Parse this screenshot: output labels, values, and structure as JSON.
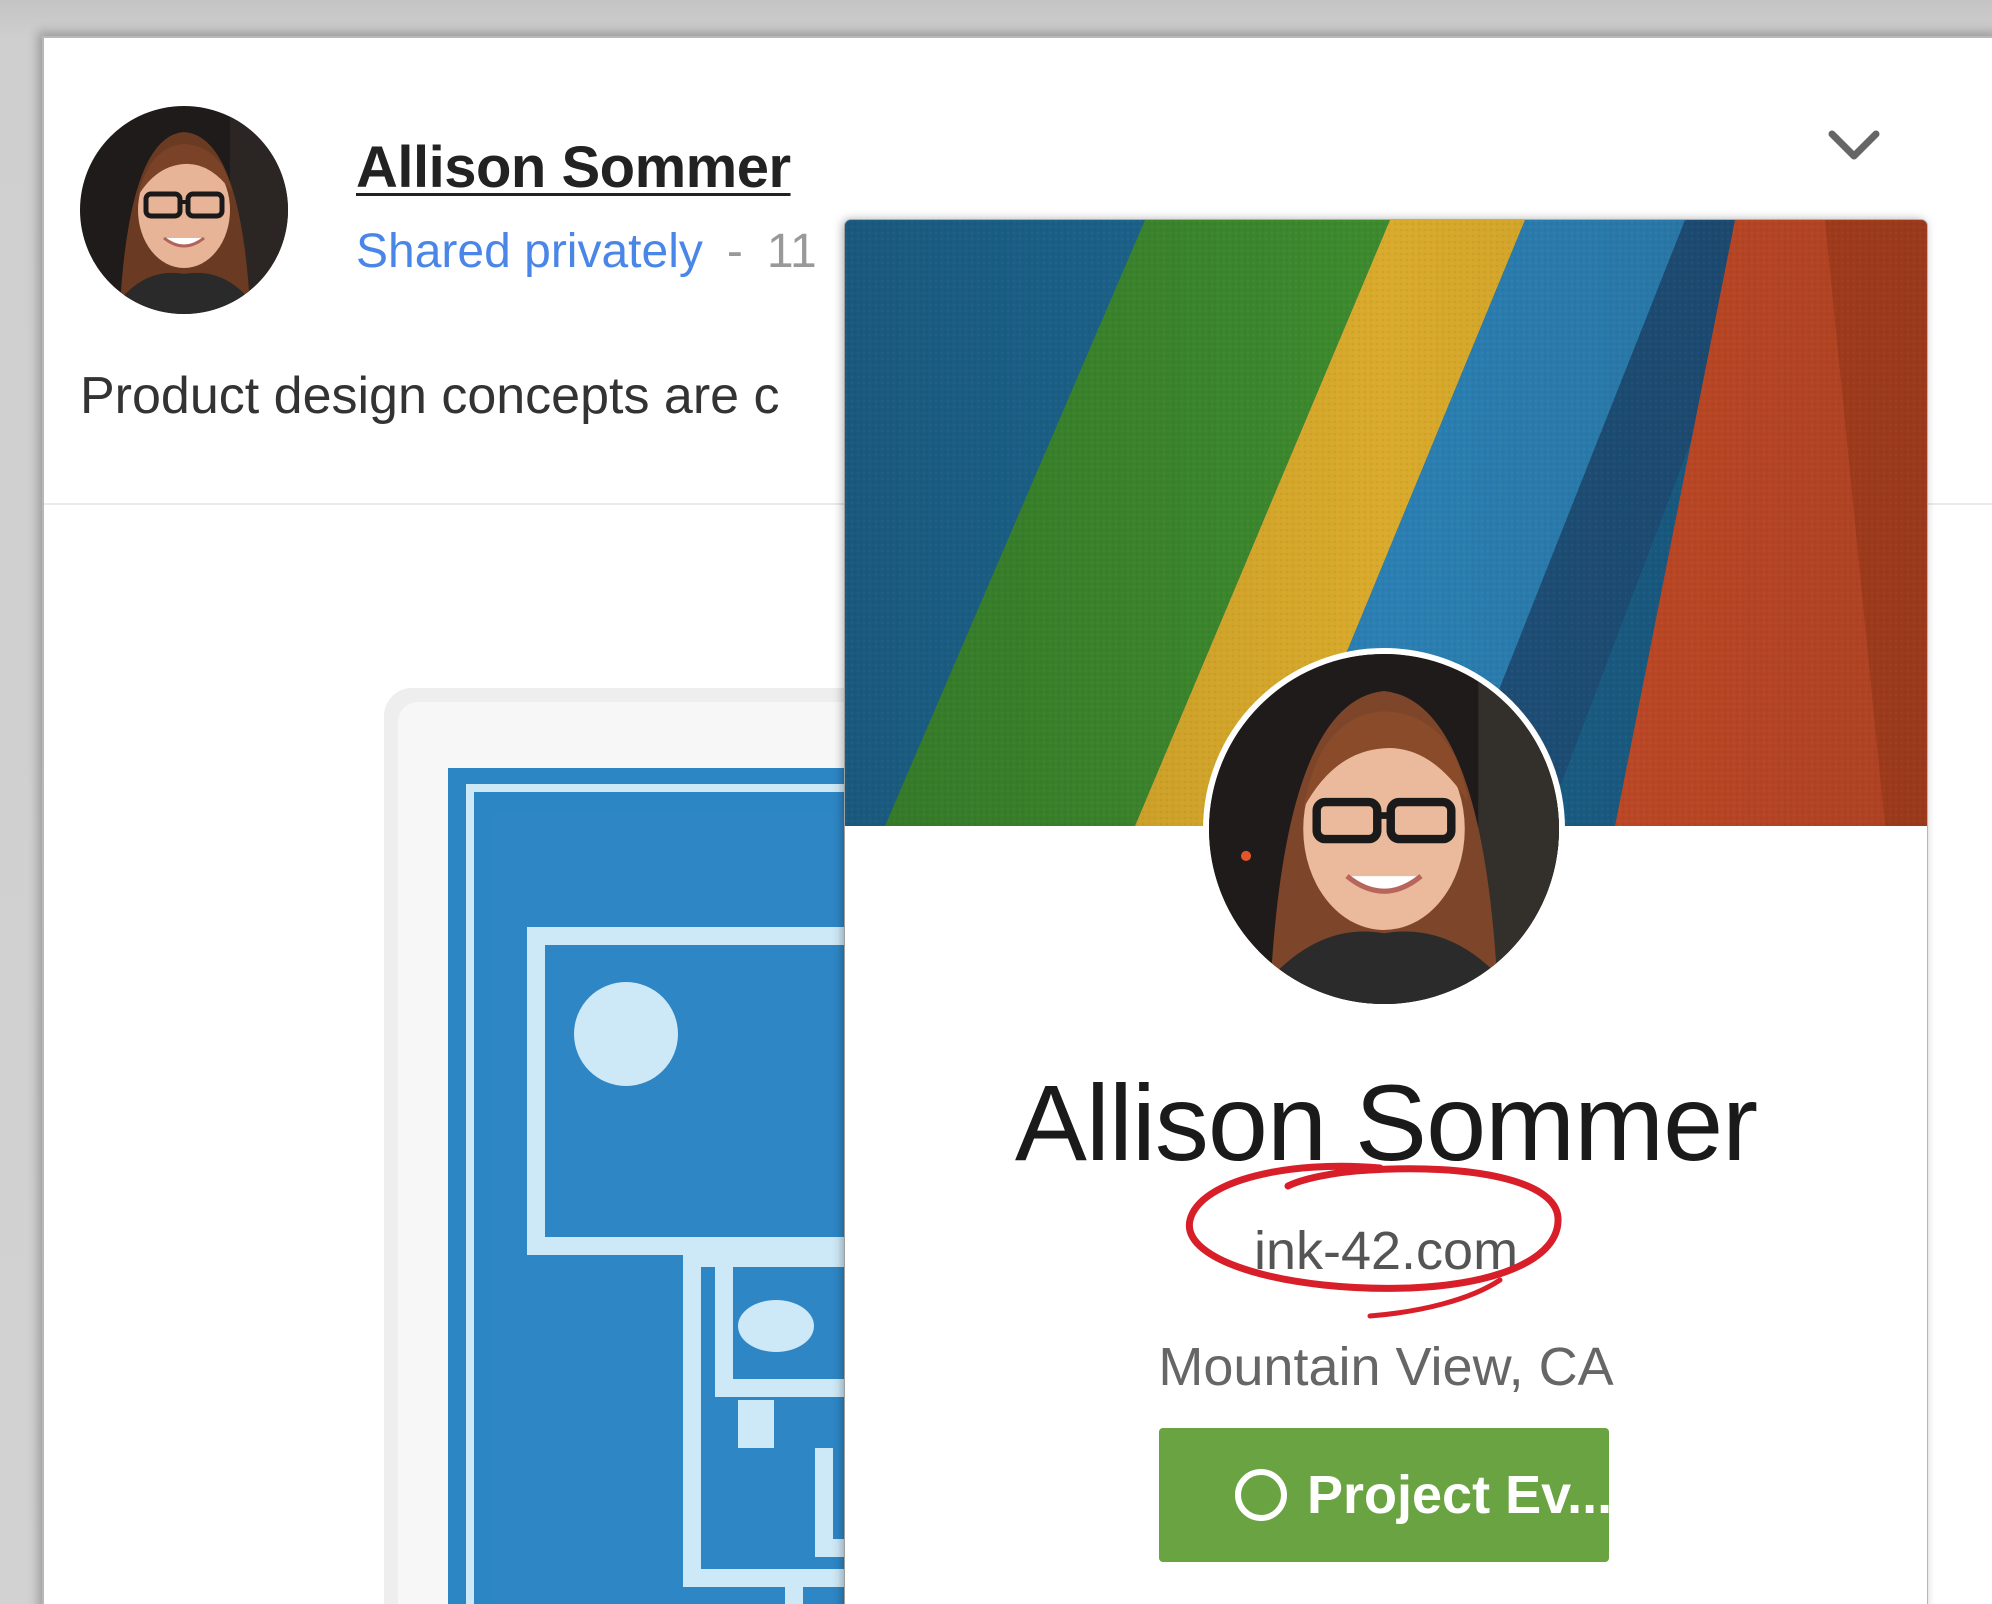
{
  "post": {
    "author": "Allison Sommer",
    "visibility": "Shared privately",
    "separator": "-",
    "time_fragment": "11",
    "text_fragment": "Product design concepts are c",
    "menu_icon": "chevron-down-icon"
  },
  "hovercard": {
    "name": "Allison Sommer",
    "website": "ink-42.com",
    "location": "Mountain View, CA",
    "button_label": "Project Ev...",
    "button_icon": "circle-outline-icon",
    "highlight_color": "#d81e28",
    "button_color": "#6aa342"
  },
  "colors": {
    "link_blue": "#4a86e8",
    "attachment_blue": "#2d86c4",
    "attachment_light": "#cde8f6"
  }
}
